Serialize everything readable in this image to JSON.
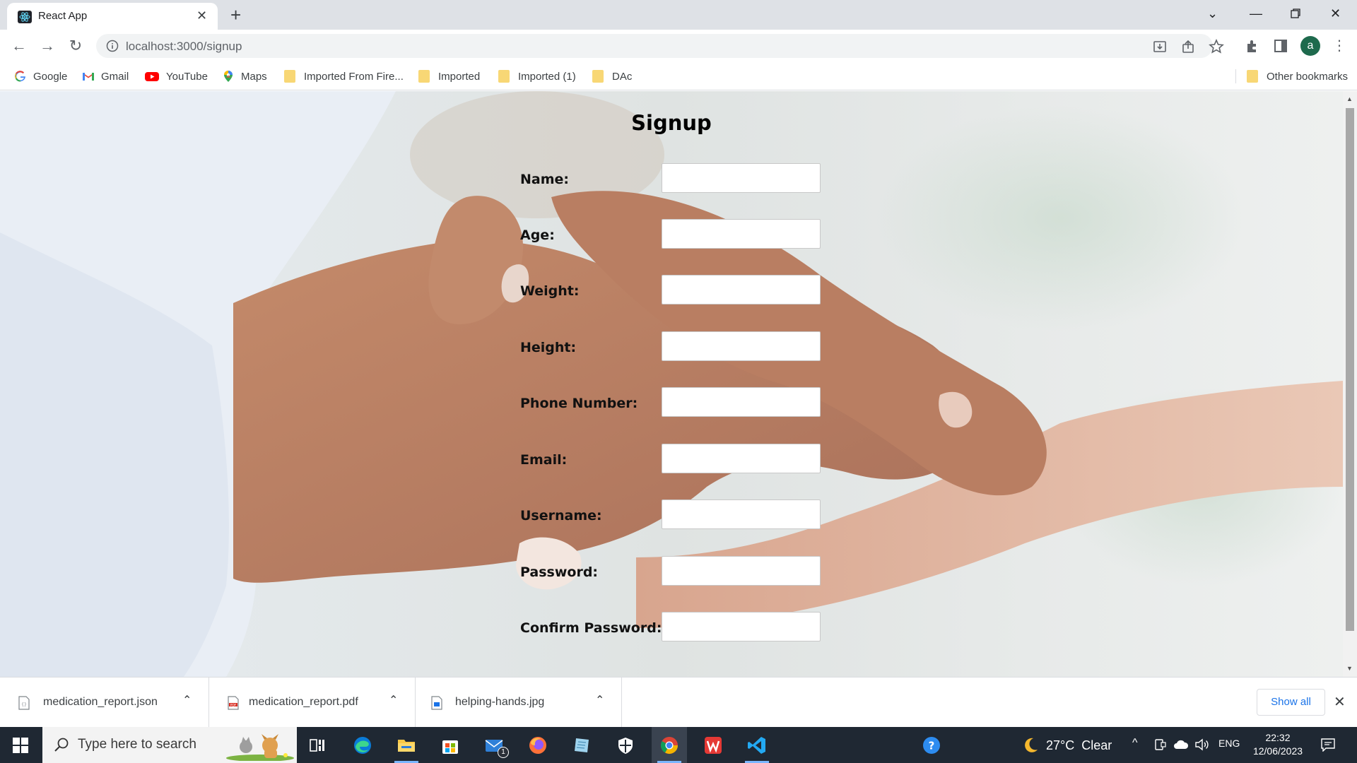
{
  "browser": {
    "tab_title": "React App",
    "url": "localhost:3000/signup",
    "avatar_letter": "a",
    "bookmarks": [
      {
        "label": "Google",
        "icon": "google-icon"
      },
      {
        "label": "Gmail",
        "icon": "gmail-icon"
      },
      {
        "label": "YouTube",
        "icon": "youtube-icon"
      },
      {
        "label": "Maps",
        "icon": "maps-icon"
      },
      {
        "label": "Imported From Fire...",
        "icon": "folder-icon"
      },
      {
        "label": "Imported",
        "icon": "folder-icon"
      },
      {
        "label": "Imported (1)",
        "icon": "folder-icon"
      },
      {
        "label": "DAc",
        "icon": "folder-icon"
      }
    ],
    "other_bookmarks": "Other bookmarks"
  },
  "page": {
    "title": "Signup",
    "fields": [
      {
        "label": "Name:",
        "value": ""
      },
      {
        "label": "Age:",
        "value": ""
      },
      {
        "label": "Weight:",
        "value": ""
      },
      {
        "label": "Height:",
        "value": ""
      },
      {
        "label": "Phone Number:",
        "value": ""
      },
      {
        "label": "Email:",
        "value": ""
      },
      {
        "label": "Username:",
        "value": ""
      },
      {
        "label": "Password:",
        "value": ""
      },
      {
        "label": "Confirm Password:",
        "value": ""
      }
    ]
  },
  "downloads": {
    "items": [
      {
        "name": "medication_report.json",
        "icon": "json-file-icon"
      },
      {
        "name": "medication_report.pdf",
        "icon": "pdf-file-icon"
      },
      {
        "name": "helping-hands.jpg",
        "icon": "image-file-icon"
      }
    ],
    "show_all": "Show all"
  },
  "taskbar": {
    "search_placeholder": "Type here to search",
    "weather": "27°C  Clear",
    "language": "ENG",
    "time": "22:32",
    "date": "12/06/2023",
    "mail_badge": "1"
  },
  "colors": {
    "accent": "#1a73e8",
    "taskbar": "#1f2833",
    "tab_strip": "#dee1e6"
  }
}
